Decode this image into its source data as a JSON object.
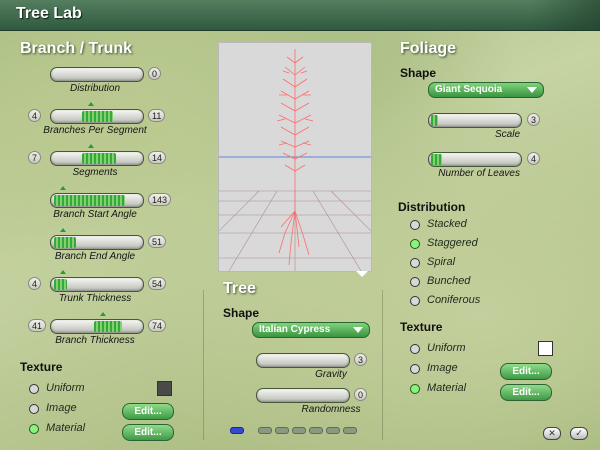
{
  "window": {
    "title": "Tree Lab"
  },
  "branch": {
    "heading": "Branch / Trunk",
    "sliders": [
      {
        "label": "Distribution",
        "min": "",
        "max": "0",
        "fill_from": 0.0,
        "fill_to": 0.0
      },
      {
        "label": "Branches Per Segment",
        "min": "4",
        "max": "11",
        "fill_from": 0.3,
        "fill_to": 0.68
      },
      {
        "label": "Segments",
        "min": "7",
        "max": "14",
        "fill_from": 0.3,
        "fill_to": 0.72
      },
      {
        "label": "Branch Start Angle",
        "min": "",
        "max": "143",
        "fill_from": 0.0,
        "fill_to": 0.82
      },
      {
        "label": "Branch End Angle",
        "min": "",
        "max": "51",
        "fill_from": 0.0,
        "fill_to": 0.28
      },
      {
        "label": "Trunk Thickness",
        "min": "4",
        "max": "54",
        "fill_from": 0.0,
        "fill_to": 0.18
      },
      {
        "label": "Branch Thickness",
        "min": "41",
        "max": "74",
        "fill_from": 0.44,
        "fill_to": 0.78
      }
    ],
    "texture_heading": "Texture",
    "texture_options": [
      {
        "label": "Uniform",
        "selected": false
      },
      {
        "label": "Image",
        "selected": false
      },
      {
        "label": "Material",
        "selected": true
      }
    ],
    "swatch_color": "#4a4a4a",
    "edit_label": "Edit..."
  },
  "tree": {
    "heading": "Tree",
    "shape_label": "Shape",
    "shape_value": "Italian Cypress",
    "sliders": [
      {
        "label": "Gravity",
        "max": "3",
        "fill_to": 0.0
      },
      {
        "label": "Randomness",
        "max": "0",
        "fill_to": 0.0
      }
    ],
    "pages": 7,
    "active_page": 0
  },
  "foliage": {
    "heading": "Foliage",
    "shape_label": "Shape",
    "shape_value": "Giant Sequoia",
    "sliders": [
      {
        "label": "Scale",
        "max": "3",
        "fill_to": 0.08
      },
      {
        "label": "Number of Leaves",
        "max": "4",
        "fill_to": 0.12
      }
    ],
    "distribution_heading": "Distribution",
    "distribution_options": [
      {
        "label": "Stacked",
        "selected": false
      },
      {
        "label": "Staggered",
        "selected": true
      },
      {
        "label": "Spiral",
        "selected": false
      },
      {
        "label": "Bunched",
        "selected": false
      },
      {
        "label": "Coniferous",
        "selected": false
      }
    ],
    "texture_heading": "Texture",
    "texture_options": [
      {
        "label": "Uniform",
        "selected": false
      },
      {
        "label": "Image",
        "selected": false
      },
      {
        "label": "Material",
        "selected": true
      }
    ],
    "swatch_color": "#ffffff",
    "edit_label": "Edit..."
  },
  "footer": {
    "cancel_icon": "close-icon",
    "ok_icon": "checkmark-icon"
  },
  "colors": {
    "accent": "#3f9a47",
    "tree_line": "#ff6b6b",
    "horizon": "#5a86d6"
  }
}
